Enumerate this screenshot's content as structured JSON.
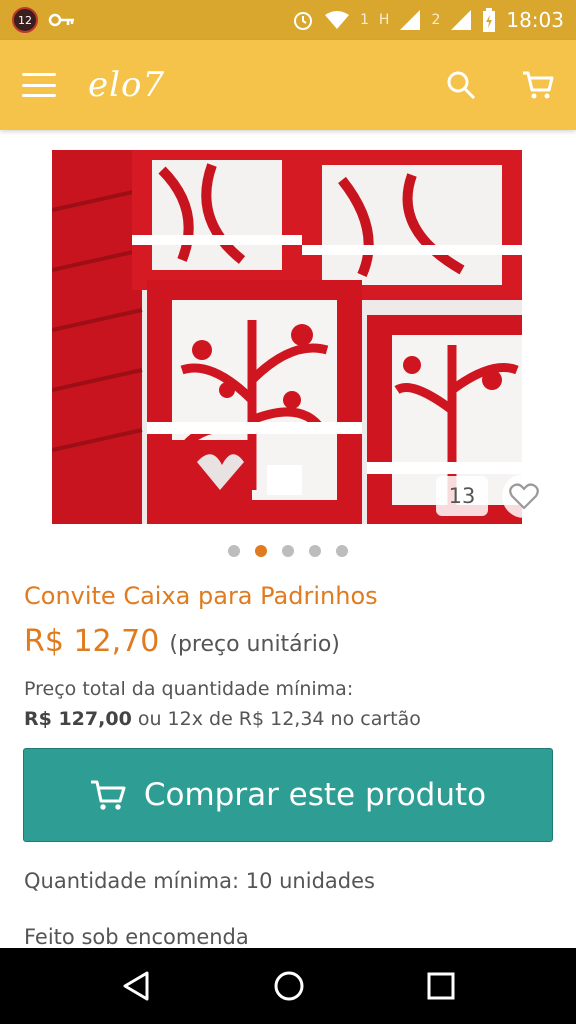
{
  "status_bar": {
    "notification_count": "12",
    "sim1_label": "1",
    "network_type": "H",
    "sim2_label": "2",
    "time": "18:03"
  },
  "app_bar": {
    "logo": "elo7"
  },
  "gallery": {
    "photo_count": "13",
    "dots_total": 5,
    "active_dot": 1
  },
  "product": {
    "title": "Convite Caixa para Padrinhos",
    "price": "R$ 12,70",
    "price_note": "(preço unitário)",
    "total_label": "Preço total da quantidade mínima:",
    "total_price": "R$ 127,00",
    "installments": "ou 12x de R$ 12,34 no cartão",
    "buy_button": "Comprar este produto",
    "min_quantity": "Quantidade mínima: 10 unidades",
    "made_to_order": "Feito sob encomenda"
  },
  "colors": {
    "status_bar": "#d9a72e",
    "app_bar": "#f5c34a",
    "accent": "#e07b20",
    "buy_button": "#2e9e94"
  }
}
